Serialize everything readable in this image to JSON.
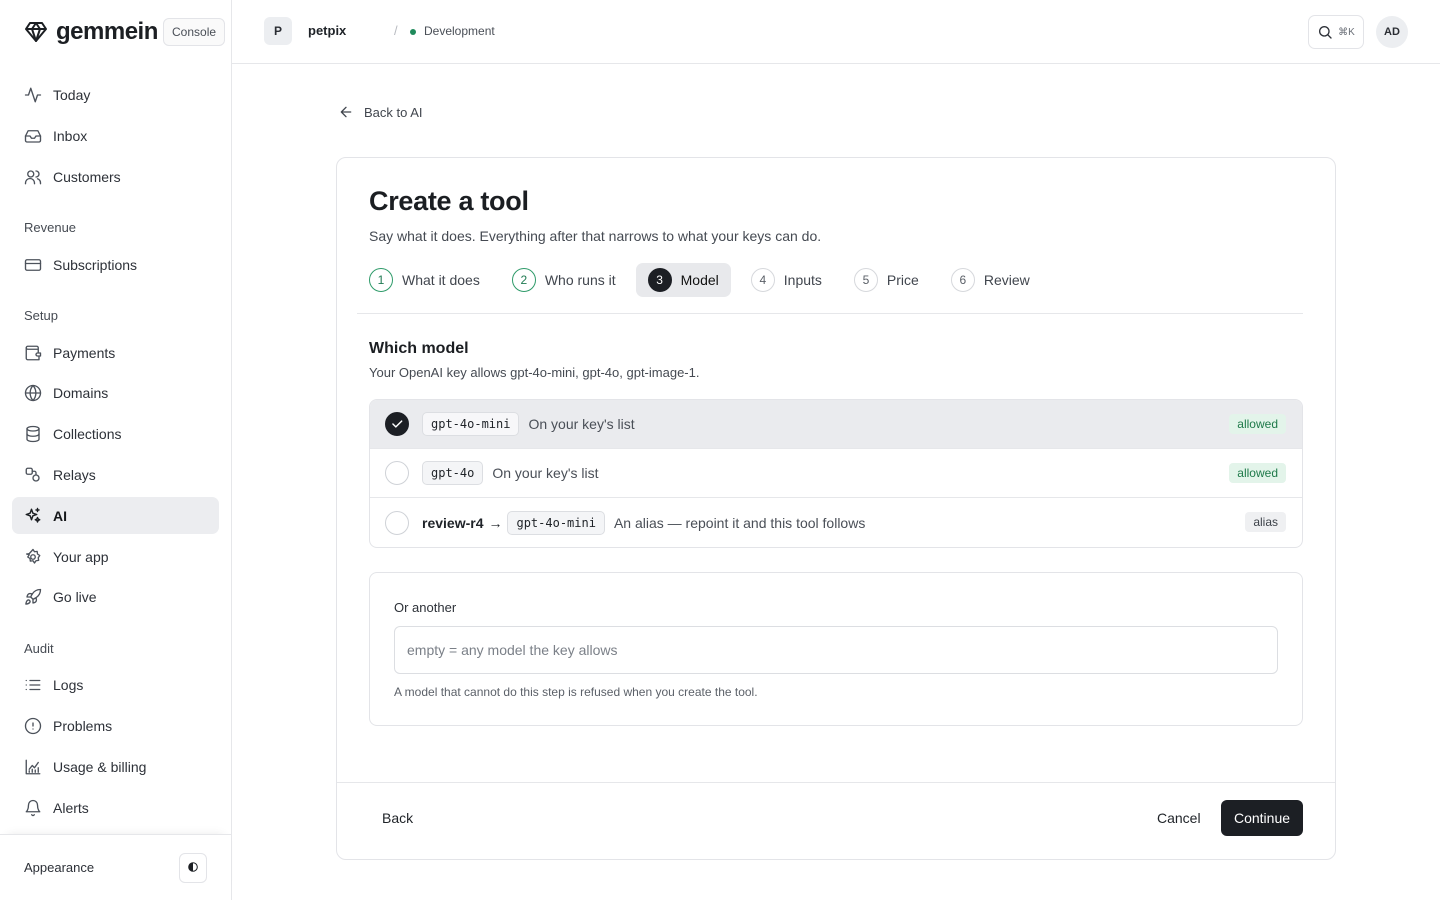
{
  "brand": {
    "name": "gemmein",
    "logo_icon": "gem-icon",
    "console_label": "Console"
  },
  "sidebar": {
    "items_top": [
      {
        "label": "Today",
        "icon": "activity-icon"
      },
      {
        "label": "Inbox",
        "icon": "inbox-icon"
      },
      {
        "label": "Customers",
        "icon": "users-icon"
      }
    ],
    "section_revenue": "Revenue",
    "items_revenue": [
      {
        "label": "Subscriptions",
        "icon": "credit-card-icon"
      }
    ],
    "section_setup": "Setup",
    "items_setup": [
      {
        "label": "Payments",
        "icon": "wallet-icon"
      },
      {
        "label": "Domains",
        "icon": "globe-icon"
      },
      {
        "label": "Collections",
        "icon": "database-icon"
      },
      {
        "label": "Relays",
        "icon": "relay-icon"
      },
      {
        "label": "AI",
        "icon": "sparkles-icon",
        "active": true
      },
      {
        "label": "Your app",
        "icon": "settings-icon"
      },
      {
        "label": "Go live",
        "icon": "rocket-icon"
      }
    ],
    "section_audit": "Audit",
    "items_audit": [
      {
        "label": "Logs",
        "icon": "list-icon"
      },
      {
        "label": "Problems",
        "icon": "alert-circle-icon"
      },
      {
        "label": "Usage & billing",
        "icon": "chart-icon"
      },
      {
        "label": "Alerts",
        "icon": "bell-icon"
      }
    ],
    "footer": {
      "appearance_label": "Appearance",
      "toggle_icon": "half-circle-icon"
    }
  },
  "topbar": {
    "project_initial": "P",
    "project_name": "petpix",
    "separator": "/",
    "environment": "Development",
    "environment_color": "#1f8a5b",
    "search_shortcut": "⌘K",
    "user_initials": "AD"
  },
  "main": {
    "back_link": "Back to AI",
    "title": "Create a tool",
    "subtitle": "Say what it does. Everything after that narrows to what your keys can do.",
    "steps": [
      {
        "num": "1",
        "label": "What it does",
        "state": "done"
      },
      {
        "num": "2",
        "label": "Who runs it",
        "state": "done"
      },
      {
        "num": "3",
        "label": "Model",
        "state": "active"
      },
      {
        "num": "4",
        "label": "Inputs",
        "state": "todo"
      },
      {
        "num": "5",
        "label": "Price",
        "state": "todo"
      },
      {
        "num": "6",
        "label": "Review",
        "state": "todo"
      }
    ],
    "section_title": "Which model",
    "section_help": "Your OpenAI key allows gpt-4o-mini, gpt-4o, gpt-image-1.",
    "models": [
      {
        "model": "gpt-4o-mini",
        "desc": "On your key's list",
        "badge": "allowed",
        "selected": true
      },
      {
        "model": "gpt-4o",
        "desc": "On your key's list",
        "badge": "allowed",
        "selected": false
      },
      {
        "alias": "review-r4",
        "arrow": "→",
        "model": "gpt-4o-mini",
        "desc": "An alias — repoint it and this tool follows",
        "badge": "alias",
        "selected": false
      }
    ],
    "other": {
      "label": "Or another",
      "placeholder": "empty = any model the key allows",
      "value": "",
      "help": "A model that cannot do this step is refused when you create the tool."
    },
    "footer": {
      "back_label": "Back",
      "cancel_label": "Cancel",
      "continue_label": "Continue"
    },
    "accent_color": "#1c1f24",
    "allowed_color": "#1f7a4a"
  }
}
